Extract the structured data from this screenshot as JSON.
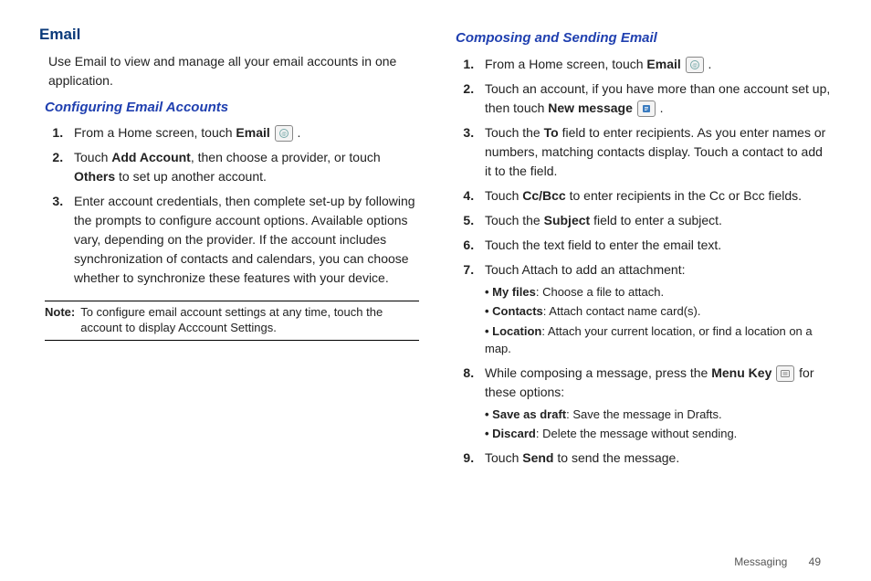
{
  "left": {
    "title": "Email",
    "intro": "Use Email to view and manage all your email accounts in one application.",
    "section_title": "Configuring Email Accounts",
    "step1_pre": "From a Home screen, touch ",
    "step1_bold": "Email",
    "step1_post": " .",
    "step2_pre": "Touch ",
    "step2_b1": "Add Account",
    "step2_mid": ", then choose a provider, or touch ",
    "step2_b2": "Others",
    "step2_post": " to set up another account.",
    "step3": "Enter account credentials, then complete set-up by following the prompts to configure account options. Available options vary, depending on the provider. If the account includes synchronization of contacts and calendars, you can choose whether to synchronize these features with your device.",
    "note_label": "Note:",
    "note_text": "To configure email account settings at any time, touch the account to display Acccount Settings."
  },
  "right": {
    "section_title": "Composing and Sending Email",
    "step1_pre": "From a Home screen, touch ",
    "step1_bold": "Email",
    "step1_post": " .",
    "step2_pre": "Touch an account, if you have more than one account set up, then touch ",
    "step2_bold": "New message",
    "step2_post": " .",
    "step3_pre": "Touch the ",
    "step3_bold": "To",
    "step3_post": " field to enter recipients. As you enter names or numbers, matching contacts display. Touch a contact to add it to the field.",
    "step4_pre": "Touch ",
    "step4_bold": "Cc/Bcc",
    "step4_post": " to enter recipients in the Cc or Bcc fields.",
    "step5_pre": "Touch the ",
    "step5_bold": "Subject",
    "step5_post": " field to enter a subject.",
    "step6": "Touch the text field to enter the email text.",
    "step7": "Touch Attach to add an attachment:",
    "bul7a_b": "My files",
    "bul7a_t": ": Choose a file to attach.",
    "bul7b_b": "Contacts",
    "bul7b_t": ": Attach contact name card(s).",
    "bul7c_b": "Location",
    "bul7c_t": ": Attach your current location, or find a location on a map.",
    "step8_pre": "While composing a message, press the ",
    "step8_bold": "Menu Key",
    "step8_post": "  for these options:",
    "bul8a_b": "Save as draft",
    "bul8a_t": ": Save the message in Drafts.",
    "bul8b_b": "Discard",
    "bul8b_t": ": Delete the message without sending.",
    "step9_pre": "Touch ",
    "step9_bold": "Send",
    "step9_post": " to send the message."
  },
  "footer": {
    "chapter": "Messaging",
    "page": "49"
  }
}
